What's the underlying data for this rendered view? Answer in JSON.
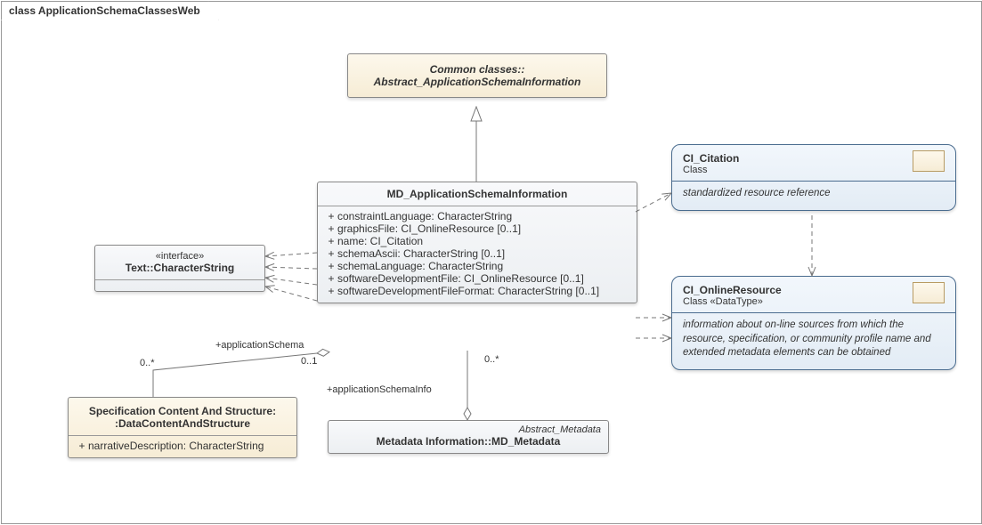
{
  "frame": {
    "label": "class ApplicationSchemaClassesWeb"
  },
  "abstract_asi": {
    "line1": "Common classes::",
    "line2": "Abstract_ApplicationSchemaInformation"
  },
  "md_asi": {
    "title": "MD_ApplicationSchemaInformation",
    "attrs": [
      "constraintLanguage: CharacterString",
      "graphicsFile: CI_OnlineResource [0..1]",
      "name: CI_Citation",
      "schemaAscii: CharacterString [0..1]",
      "schemaLanguage: CharacterString",
      "softwareDevelopmentFile: CI_OnlineResource [0..1]",
      "softwareDevelopmentFileFormat: CharacterString [0..1]"
    ]
  },
  "charstring": {
    "stereo": "«interface»",
    "title": "Text::CharacterString"
  },
  "spec_content": {
    "title_l1": "Specification Content And Structure:",
    "title_l2": ":DataContentAndStructure",
    "attr": "narrativeDescription: CharacterString"
  },
  "md_metadata": {
    "role": "Abstract_Metadata",
    "title": "Metadata Information::MD_Metadata"
  },
  "ci_citation": {
    "name": "CI_Citation",
    "kind": "Class",
    "desc": "standardized resource reference"
  },
  "ci_online": {
    "name": "CI_OnlineResource",
    "kind": "Class «DataType»",
    "desc": "information about on-line sources from which the resource, specification, or community profile name and extended metadata elements can be obtained"
  },
  "labels": {
    "app_schema_role": "+applicationSchema",
    "app_schema_mult_far": "0..*",
    "app_schema_mult_near": "0..1",
    "app_schema_info_role": "+applicationSchemaInfo",
    "app_schema_info_mult": "0..*"
  },
  "chart_data": {
    "type": "table",
    "diagram_kind": "UML class diagram",
    "title": "ApplicationSchemaClassesWeb",
    "classes": [
      {
        "name": "Common classes::Abstract_ApplicationSchemaInformation",
        "abstract": true
      },
      {
        "name": "MD_ApplicationSchemaInformation",
        "attributes": [
          {
            "vis": "+",
            "name": "constraintLanguage",
            "type": "CharacterString"
          },
          {
            "vis": "+",
            "name": "graphicsFile",
            "type": "CI_OnlineResource",
            "mult": "0..1"
          },
          {
            "vis": "+",
            "name": "name",
            "type": "CI_Citation"
          },
          {
            "vis": "+",
            "name": "schemaAscii",
            "type": "CharacterString",
            "mult": "0..1"
          },
          {
            "vis": "+",
            "name": "schemaLanguage",
            "type": "CharacterString"
          },
          {
            "vis": "+",
            "name": "softwareDevelopmentFile",
            "type": "CI_OnlineResource",
            "mult": "0..1"
          },
          {
            "vis": "+",
            "name": "softwareDevelopmentFileFormat",
            "type": "CharacterString",
            "mult": "0..1"
          }
        ]
      },
      {
        "name": "Text::CharacterString",
        "stereotype": "interface"
      },
      {
        "name": "Specification Content And Structure::DataContentAndStructure",
        "attributes": [
          {
            "vis": "+",
            "name": "narrativeDescription",
            "type": "CharacterString"
          }
        ]
      },
      {
        "name": "Metadata Information::MD_Metadata",
        "role_in_diagram": "Abstract_Metadata"
      },
      {
        "name": "CI_Citation",
        "kind": "Class",
        "note": "standardized resource reference"
      },
      {
        "name": "CI_OnlineResource",
        "kind": "Class «DataType»",
        "note": "information about on-line sources from which the resource, specification, or community profile name and extended metadata elements can be obtained"
      }
    ],
    "relationships": [
      {
        "type": "generalization",
        "from": "MD_ApplicationSchemaInformation",
        "to": "Common classes::Abstract_ApplicationSchemaInformation"
      },
      {
        "type": "dependency",
        "from": "MD_ApplicationSchemaInformation",
        "to": "Text::CharacterString",
        "count": 4
      },
      {
        "type": "dependency",
        "from": "MD_ApplicationSchemaInformation",
        "to": "CI_Citation"
      },
      {
        "type": "dependency",
        "from": "MD_ApplicationSchemaInformation",
        "to": "CI_OnlineResource",
        "count": 2
      },
      {
        "type": "dependency",
        "from": "CI_Citation",
        "to": "CI_OnlineResource"
      },
      {
        "type": "aggregation",
        "whole": "Specification Content And Structure::DataContentAndStructure",
        "part": "MD_ApplicationSchemaInformation",
        "roles": {
          "part": "+applicationSchema"
        },
        "multiplicity": {
          "whole": "0..*",
          "part": "0..1"
        }
      },
      {
        "type": "aggregation",
        "whole": "Metadata Information::MD_Metadata",
        "part": "MD_ApplicationSchemaInformation",
        "roles": {
          "part": "+applicationSchemaInfo"
        },
        "multiplicity": {
          "part": "0..*"
        }
      }
    ]
  }
}
